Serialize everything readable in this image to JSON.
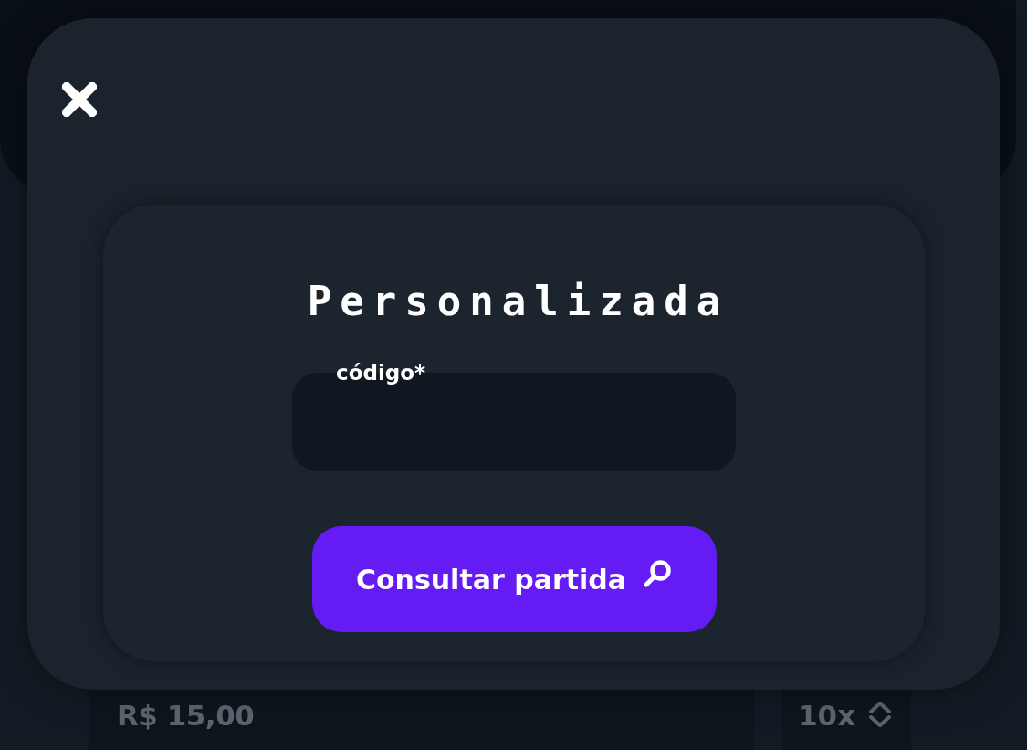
{
  "modal": {
    "title": "Personalizada",
    "field": {
      "label": "código*"
    },
    "button": {
      "label": "Consultar partida"
    }
  },
  "background": {
    "amount": "R$ 15,00",
    "multiplier": "10x"
  }
}
